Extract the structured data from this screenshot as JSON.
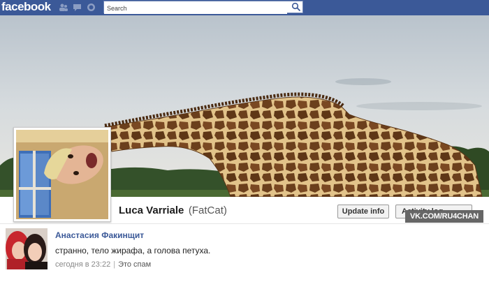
{
  "topbar": {
    "logo": "facebook",
    "search_placeholder": "Search",
    "icons": [
      "friend-requests-icon",
      "messages-icon",
      "notifications-icon",
      "search-icon"
    ]
  },
  "profile": {
    "name": "Luca Varriale",
    "nickname": "(FatCat)",
    "update_info_label": "Update info",
    "activity_log_label": "Activity log"
  },
  "watermark": "VK.COM/RU4CHAN",
  "comment": {
    "author": "Анастасия Факинщит",
    "text": "странно, тело жирафа, а голова петуха.",
    "time": "сегодня в 23:22",
    "spam_label": "Это спам"
  },
  "colors": {
    "topbar": "#3b5998",
    "link": "#3b5998",
    "cover_sky": "#c9d0d6",
    "giraffe_base": "#d9b77c",
    "giraffe_spots": "#6b3f1c"
  }
}
